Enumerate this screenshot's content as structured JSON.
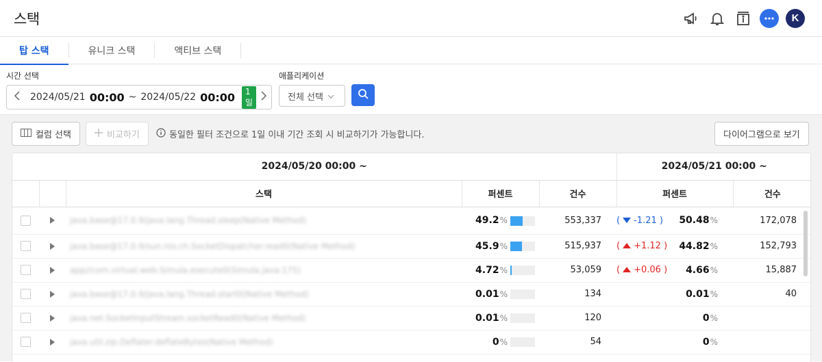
{
  "header": {
    "title": "스택",
    "avatar_letter": "K"
  },
  "tabs": [
    {
      "label": "탑 스택",
      "active": true
    },
    {
      "label": "유니크 스택",
      "active": false
    },
    {
      "label": "액티브 스택",
      "active": false
    }
  ],
  "filters": {
    "time_label": "시간 선택",
    "start_date": "2024/05/21",
    "start_time": "00:00",
    "separator": "~",
    "end_date": "2024/05/22",
    "end_time": "00:00",
    "range_badge": "1일",
    "app_label": "애플리케이션",
    "app_value": "전체 선택"
  },
  "toolbar": {
    "column_select": "컬럼 선택",
    "compare": "비교하기",
    "hint": "동일한 필터 조건으로 1일 이내 기간 조회 시 비교하기가 가능합니다.",
    "diagram": "다이어그램으로 보기"
  },
  "table": {
    "group_prev": "2024/05/20 00:00 ~",
    "group_curr": "2024/05/21 00:00 ~",
    "col_stack": "스택",
    "col_percent": "퍼센트",
    "col_count": "건수",
    "col_percent2": "퍼센트",
    "col_count2": "건수",
    "rows": [
      {
        "stack": "java.base@17.0.9/java.lang.Thread.sleep(Native Method)",
        "prev_pct": "49.2",
        "prev_bar": 0.492,
        "prev_count": "553,337",
        "dir": "down",
        "change": "-1.21",
        "curr_pct": "50.48",
        "curr_count": "172,078"
      },
      {
        "stack": "java.base@17.0.9/sun.nio.ch.SocketDispatcher.read0(Native Method)",
        "prev_pct": "45.9",
        "prev_bar": 0.459,
        "prev_count": "515,937",
        "dir": "up",
        "change": "+1.12",
        "curr_pct": "44.82",
        "curr_count": "152,793"
      },
      {
        "stack": "app//com.virtual.web.Simula.execute0(Simula.java:175)",
        "prev_pct": "4.72",
        "prev_bar": 0.0472,
        "prev_count": "53,059",
        "dir": "up",
        "change": "+0.06",
        "curr_pct": "4.66",
        "curr_count": "15,887"
      },
      {
        "stack": "java.base@17.0.9/java.lang.Thread.start0(Native Method)",
        "prev_pct": "0.01",
        "prev_bar": 0.0001,
        "prev_count": "134",
        "dir": "",
        "change": "",
        "curr_pct": "0.01",
        "curr_count": "40"
      },
      {
        "stack": "java.net.SocketInputStream.socketRead0(Native Method)",
        "prev_pct": "0.01",
        "prev_bar": 0.0001,
        "prev_count": "120",
        "dir": "",
        "change": "",
        "curr_pct": "0",
        "curr_count": ""
      },
      {
        "stack": "java.util.zip.Deflater.deflateBytes(Native Method)",
        "prev_pct": "0",
        "prev_bar": 0,
        "prev_count": "54",
        "dir": "",
        "change": "",
        "curr_pct": "0",
        "curr_count": ""
      }
    ]
  },
  "colors": {
    "accent": "#1a5fd6",
    "badge": "#1fa34a",
    "up": "#e02424",
    "down": "#1a5fd6",
    "bar": "#3aa2f0"
  }
}
